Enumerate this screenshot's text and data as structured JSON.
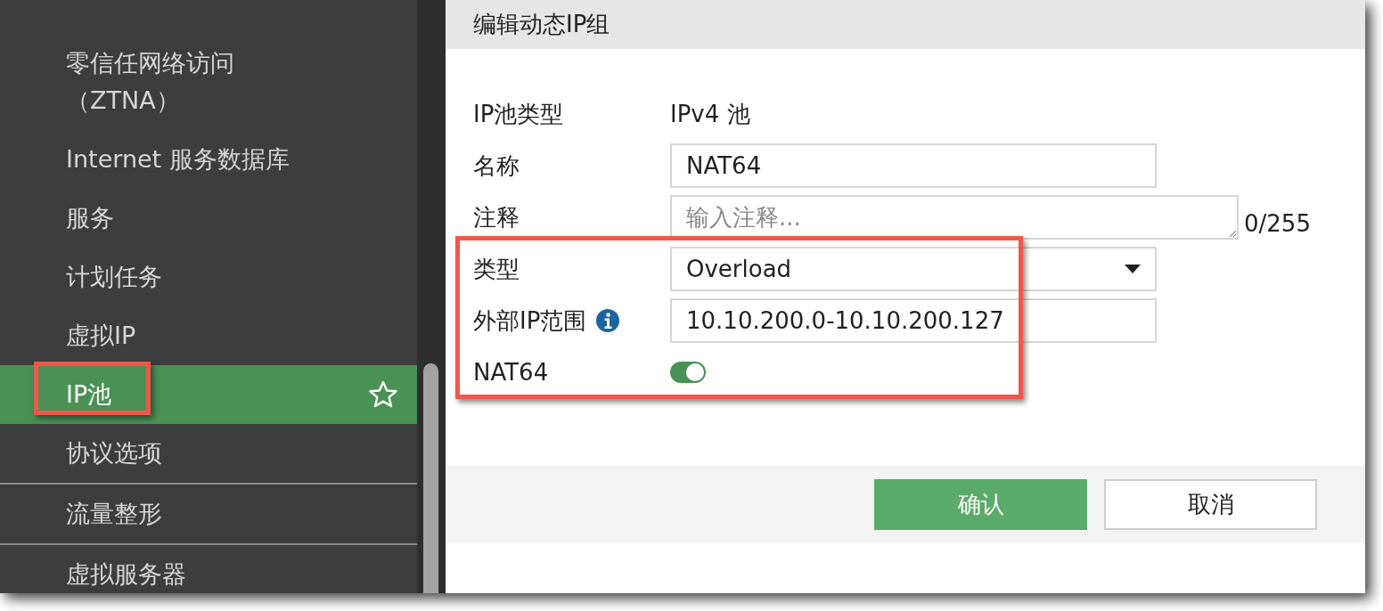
{
  "sidebar": {
    "items": [
      {
        "label": "零信任网络访问（ZTNA）",
        "selected": false,
        "divider_above": false
      },
      {
        "label": "Internet 服务数据库",
        "selected": false,
        "divider_above": false
      },
      {
        "label": "服务",
        "selected": false,
        "divider_above": false
      },
      {
        "label": "计划任务",
        "selected": false,
        "divider_above": false
      },
      {
        "label": "虚拟IP",
        "selected": false,
        "divider_above": false
      },
      {
        "label": "IP池",
        "selected": true,
        "divider_above": false
      },
      {
        "label": "协议选项",
        "selected": false,
        "divider_above": false
      },
      {
        "label": "流量整形",
        "selected": false,
        "divider_above": true
      },
      {
        "label": "虚拟服务器",
        "selected": false,
        "divider_above": true
      }
    ]
  },
  "dialog": {
    "title": "编辑动态IP组",
    "fields": [
      {
        "kind": "text",
        "label": "IP池类型",
        "value": "IPv4 池"
      },
      {
        "kind": "input",
        "label": "名称",
        "value": "NAT64"
      },
      {
        "kind": "textarea",
        "label": "注释",
        "placeholder": "输入注释...",
        "counter": "0/255"
      },
      {
        "kind": "select",
        "label": "类型",
        "value": "Overload"
      },
      {
        "kind": "input",
        "label": "外部IP范围",
        "value": "10.10.200.0-10.10.200.127",
        "info": true
      },
      {
        "kind": "toggle",
        "label": "NAT64",
        "on": true
      }
    ],
    "buttons": [
      {
        "label": "确认",
        "kind": "primary"
      },
      {
        "label": "取消",
        "kind": "secondary"
      }
    ]
  }
}
